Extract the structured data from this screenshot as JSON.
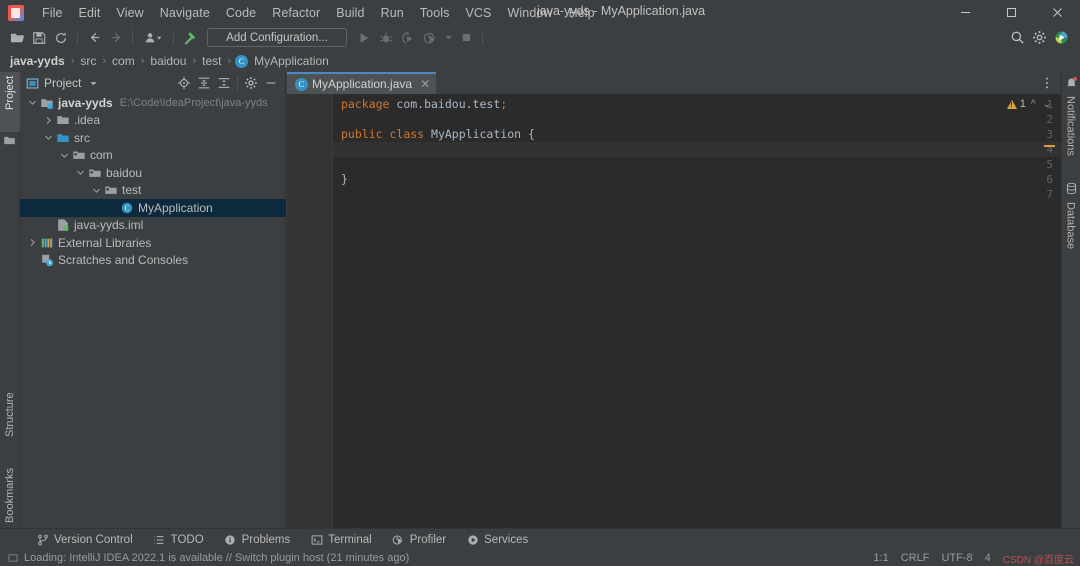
{
  "window": {
    "title": "java-yyds - MyApplication.java",
    "minimize_label": "─",
    "maximize_label": "❐",
    "close_label": "✕"
  },
  "menubar": {
    "items": [
      {
        "label": "File"
      },
      {
        "label": "Edit"
      },
      {
        "label": "View"
      },
      {
        "label": "Navigate"
      },
      {
        "label": "Code"
      },
      {
        "label": "Refactor"
      },
      {
        "label": "Build"
      },
      {
        "label": "Run"
      },
      {
        "label": "Tools"
      },
      {
        "label": "VCS"
      },
      {
        "label": "Window"
      },
      {
        "label": "Help"
      }
    ]
  },
  "toolbar": {
    "open_icon": "folder-open-icon",
    "save_icon": "save-icon",
    "sync_icon": "sync-icon",
    "back_icon": "arrow-left-icon",
    "forward_icon": "arrow-right-icon",
    "profile_icon": "user-dropdown-icon",
    "build_icon": "hammer-icon",
    "run_config_label": "Add Configuration...",
    "run_icon": "run-icon",
    "debug_icon": "debug-icon",
    "run_coverage_icon": "run-with-coverage-icon",
    "profile_run_icon": "profile-run-icon",
    "stop_icon": "stop-icon",
    "search_icon": "search-icon",
    "settings_icon": "gear-icon",
    "ide_icon": "ide-badge-icon"
  },
  "breadcrumb": {
    "items": [
      "java-yyds",
      "src",
      "com",
      "baidou",
      "test"
    ],
    "separator": "›",
    "final_item": "MyApplication",
    "final_badge": "C"
  },
  "left_strip": {
    "tabs": [
      {
        "label": "Project",
        "active": true
      },
      {
        "label": "Structure",
        "active": false
      },
      {
        "label": "Bookmarks",
        "active": false
      }
    ]
  },
  "right_strip": {
    "tabs": [
      {
        "label": "Notifications"
      },
      {
        "label": "Database"
      }
    ]
  },
  "project_panel": {
    "title": "Project",
    "dropdown_icon": "chevron-down-icon",
    "locate_icon": "crosshair-icon",
    "expand_icon": "expand-all-icon",
    "collapse_icon": "collapse-all-icon",
    "settings_icon": "gear-icon",
    "hide_icon": "minimize-icon",
    "tree": [
      {
        "label": "java-yyds",
        "path": "E:\\Code\\IdeaProject\\java-yyds",
        "indent": 0,
        "arrow": "down",
        "icon": "module-icon",
        "bold": true,
        "selected": false
      },
      {
        "label": ".idea",
        "path": "",
        "indent": 1,
        "arrow": "right",
        "icon": "folder-icon",
        "bold": false,
        "selected": false
      },
      {
        "label": "src",
        "path": "",
        "indent": 1,
        "arrow": "down",
        "icon": "source-folder-icon",
        "bold": false,
        "selected": false
      },
      {
        "label": "com",
        "path": "",
        "indent": 2,
        "arrow": "down",
        "icon": "package-icon",
        "bold": false,
        "selected": false
      },
      {
        "label": "baidou",
        "path": "",
        "indent": 3,
        "arrow": "down",
        "icon": "package-icon",
        "bold": false,
        "selected": false
      },
      {
        "label": "test",
        "path": "",
        "indent": 4,
        "arrow": "down",
        "icon": "package-icon",
        "bold": false,
        "selected": false
      },
      {
        "label": "MyApplication",
        "path": "",
        "indent": 5,
        "arrow": "none",
        "icon": "java-class-icon",
        "bold": false,
        "selected": true
      },
      {
        "label": "java-yyds.iml",
        "path": "",
        "indent": 1,
        "arrow": "none",
        "icon": "iml-file-icon",
        "bold": false,
        "selected": false
      },
      {
        "label": "External Libraries",
        "path": "",
        "indent": 0,
        "arrow": "right",
        "icon": "libraries-icon",
        "bold": false,
        "selected": false
      },
      {
        "label": "Scratches and Consoles",
        "path": "",
        "indent": 0,
        "arrow": "none",
        "icon": "scratches-icon",
        "bold": false,
        "selected": false
      }
    ]
  },
  "editor": {
    "tab": {
      "label": "MyApplication.java",
      "badge": "C",
      "close": "✕"
    },
    "more_icon": "more-options-icon",
    "line_numbers": [
      "1",
      "2",
      "3",
      "4",
      "5",
      "6",
      "7"
    ],
    "current_line": 4,
    "code": [
      {
        "line": 1,
        "tokens": [
          {
            "t": "package",
            "c": "kw"
          },
          {
            "t": " com.baidou.test",
            "c": "plain"
          },
          {
            "t": ";",
            "c": "semi"
          }
        ]
      },
      {
        "line": 2,
        "tokens": []
      },
      {
        "line": 3,
        "tokens": [
          {
            "t": "public",
            "c": "kw"
          },
          {
            "t": " ",
            "c": "plain"
          },
          {
            "t": "class",
            "c": "kw"
          },
          {
            "t": " MyApplication {",
            "c": "cls"
          }
        ]
      },
      {
        "line": 4,
        "tokens": []
      },
      {
        "line": 5,
        "tokens": []
      },
      {
        "line": 6,
        "tokens": [
          {
            "t": "}",
            "c": "plain"
          }
        ]
      },
      {
        "line": 7,
        "tokens": []
      }
    ],
    "inspection": {
      "warning_count": "1",
      "up_icon": "chevron-up-icon",
      "down_icon": "chevron-down-icon"
    }
  },
  "bottom_tabs": [
    {
      "label": "Version Control",
      "icon": "branch-icon"
    },
    {
      "label": "TODO",
      "icon": "list-icon"
    },
    {
      "label": "Problems",
      "icon": "warning-circle-icon"
    },
    {
      "label": "Terminal",
      "icon": "terminal-icon"
    },
    {
      "label": "Profiler",
      "icon": "profiler-icon"
    },
    {
      "label": "Services",
      "icon": "services-icon"
    }
  ],
  "statusbar": {
    "message": "Loading: IntelliJ IDEA 2022.1 is available // Switch plugin host (21 minutes ago)",
    "caret": "1:1",
    "line_sep": "CRLF",
    "encoding": "UTF-8",
    "indent": "4",
    "watermark": "CSDN @百度云"
  },
  "colors": {
    "chrome": "#3c3f41",
    "editor_bg": "#2b2b2b",
    "gutter_bg": "#313335",
    "selection": "#0d293e",
    "accent": "#4a88c7",
    "keyword": "#cc7832",
    "warning": "#d9a343"
  }
}
